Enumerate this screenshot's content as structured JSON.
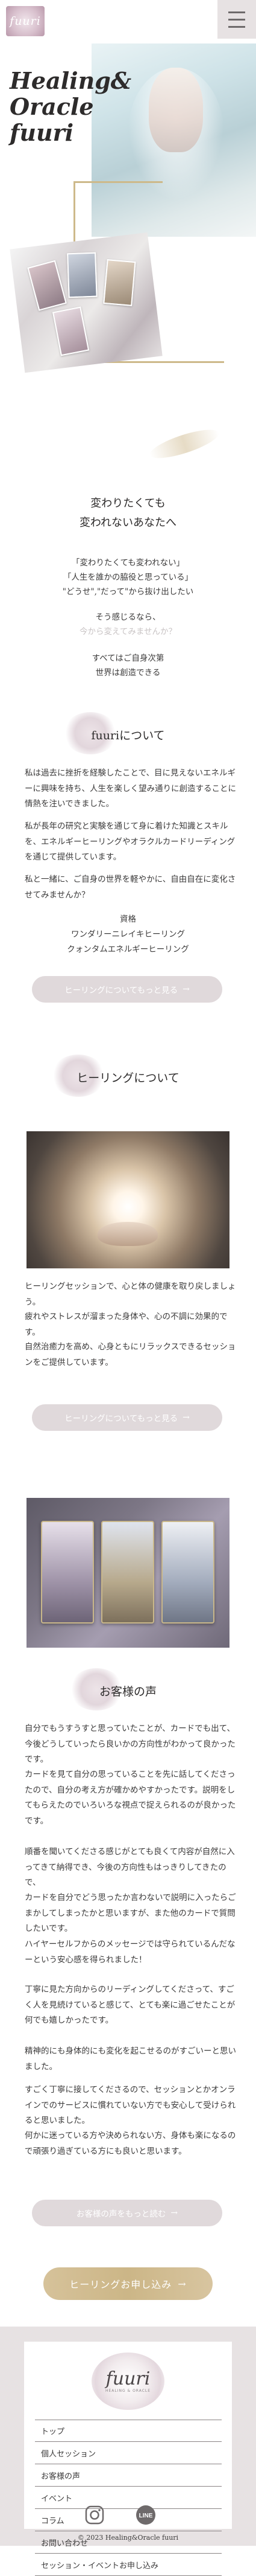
{
  "header": {
    "logo_text": "fuuri",
    "menu_icon": "hamburger-menu-icon"
  },
  "hero": {
    "title_lines": [
      "Healing&",
      "Oracle",
      "fuuri"
    ]
  },
  "intro": {
    "title_lines": [
      "変わりたくても",
      "変われないあなたへ"
    ],
    "quotes": [
      "「変わりたくても変われない」",
      "「人生を誰かの脇役と思っている」",
      "\"どうせ\",\"だって\"から抜け出したい"
    ],
    "question_lines": [
      "そう感じるなら、",
      "今から変えてみませんか？"
    ],
    "closing_lines": [
      "すべてはご自身次第",
      "世界は創造できる"
    ]
  },
  "about": {
    "heading": "fuuriについて",
    "paragraphs": [
      "私は過去に挫折を経験したことで、目に見えないエネルギーに興味を持ち、人生を楽しく望み通りに創造することに情熱を注いできました。",
      "私が長年の研究と実験を通じて身に着けた知識とスキルを、エネルギーヒーリングやオラクルカードリーディングを通じて提供しています。",
      "私と一緒に、ご自身の世界を軽やかに、自由自在に変化させてみませんか？"
    ],
    "qualification_label": "資格",
    "qualifications": [
      "ワンダリーニレイキヒーリング",
      "クォンタムエネルギーヒーリング"
    ],
    "more_button": "ヒーリングについてもっと見る",
    "arrow_icon": "arrow-right-icon"
  },
  "healing": {
    "heading": "ヒーリングについて",
    "paragraphs": [
      "ヒーリングセッションで、心と体の健康を取り戻しましょう。",
      "疲れやストレスが溜まった身体や、心の不調に効果的です。",
      "自然治癒力を高め、心身ともにリラックスできるセッションをご提供しています。"
    ],
    "more_button": "ヒーリングについてもっと見る"
  },
  "testimonials": {
    "heading": "お客様の声",
    "paragraphs": [
      "自分でもうすうすと思っていたことが、カードでも出て、今後どうしていったら良いかの方向性がわかって良かったです。",
      "カードを見て自分の思っていることを先に話してくださったので、自分の考え方が確かめやすかったです。説明をしてもらえたのでいろいろな視点で捉えられるのが良かったです。",
      "順番を聞いてくださる感じがとても良くて内容が自然に入ってきて納得でき、今後の方向性もはっきりしてきたので、",
      "カードを自分でどう思ったか言わないで説明に入ったらごまかしてしまったかと思いますが、また他のカードで質問したいです。",
      "ハイヤーセルフからのメッセージでは守られているんだなーという安心感を得られました！",
      "丁寧に見た方向からのリーディングしてくださって、すごく人を見続けていると感じて、とても楽に過ごせたことが何でも嬉しかったです。",
      "精神的にも身体的にも変化を起こせるのがすごいーと思いました。",
      "すごく丁寧に接してくださるので、セッションとかオンラインでのサービスに慣れていない方でも安心して受けられると思いました。",
      "何かに迷っている方や決められない方、身体も楽になるので頑張り過ぎている方にも良いと思います。"
    ],
    "more_button": "お客様の声をもっと読む"
  },
  "cta": {
    "label": "ヒーリングお申し込み",
    "arrow_icon": "arrow-right-icon"
  },
  "footer": {
    "logo_name": "fuuri",
    "logo_sub": "HEALING & ORACLE",
    "nav": [
      "トップ",
      "個人セッション",
      "お客様の声",
      "イベント",
      "コラム",
      "お問い合わせ",
      "セッション・イベントお申し込み"
    ],
    "social": [
      "instagram-icon",
      "line-icon"
    ],
    "line_text": "LINE",
    "copyright": "© 2023 Healing&Oracle fuuri"
  }
}
